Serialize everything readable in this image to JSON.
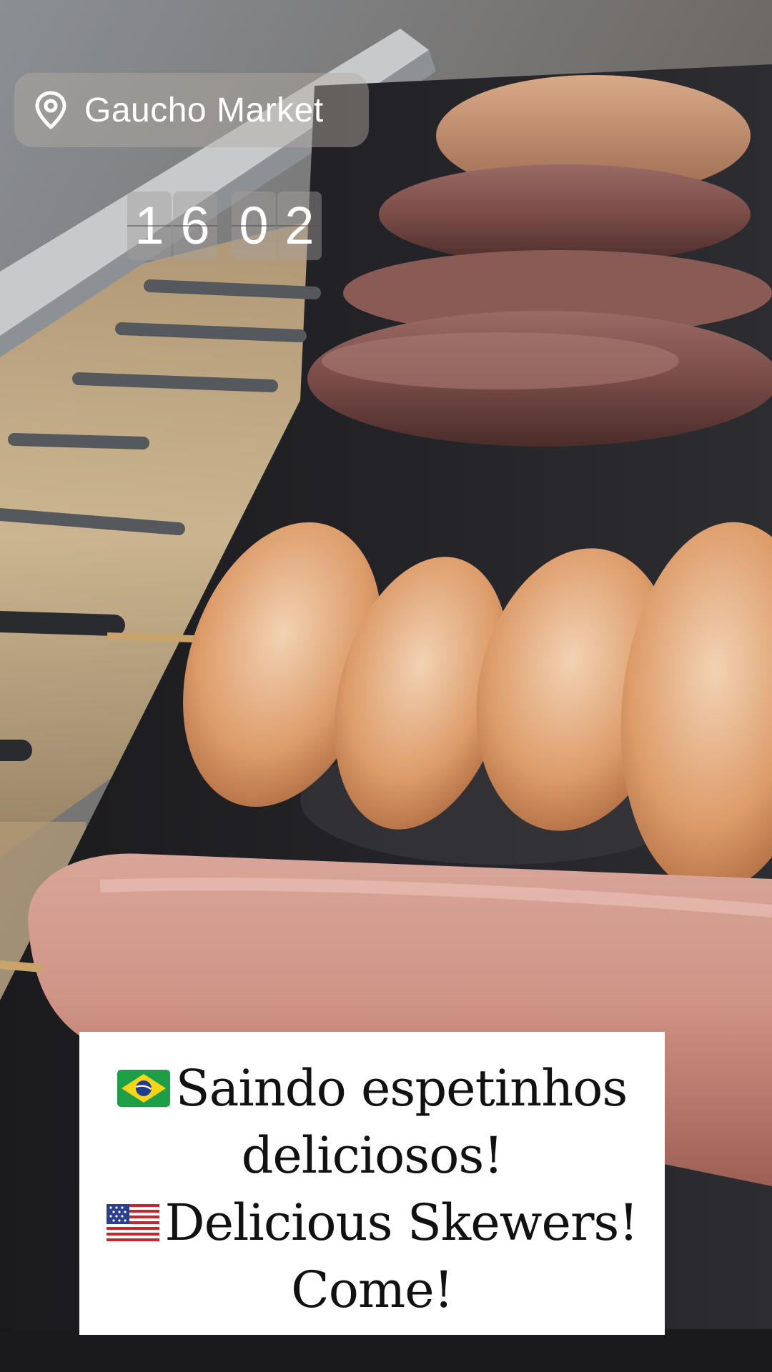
{
  "story": {
    "location_sticker": {
      "icon": "location-pin-icon",
      "label": "Gaucho Market"
    },
    "clock": {
      "digits": [
        "1",
        "6",
        "0",
        "2"
      ],
      "display": "16 02"
    },
    "caption": {
      "line1_flag": "brazil-flag-icon",
      "line1": "Saindo espetinhos",
      "line2": "deliciosos!",
      "line3_flag": "usa-flag-icon",
      "line3": "Delicious Skewers!",
      "line4": "Come!"
    }
  },
  "colors": {
    "sticker_bg": "#B4ACA5",
    "caption_bg": "#FFFFFF",
    "caption_text": "#111111",
    "grill": "#1E1E22",
    "chicken": "#D9956A",
    "sausage": "#C98D80"
  }
}
